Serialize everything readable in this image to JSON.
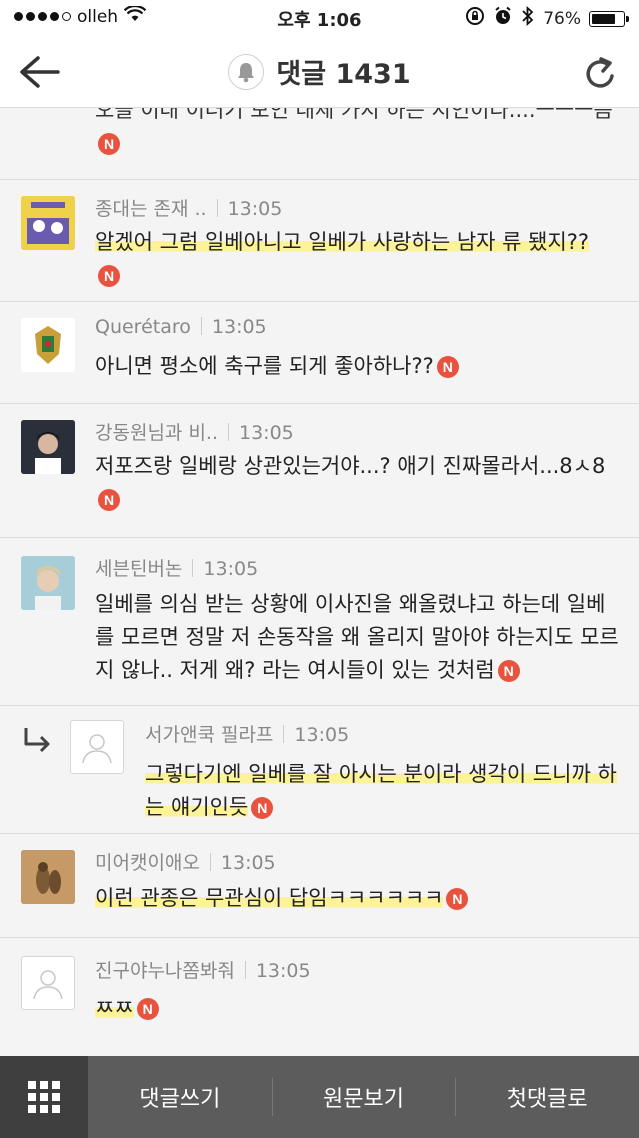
{
  "status_bar": {
    "carrier": "olleh",
    "time": "오후 1:06",
    "battery": "76%",
    "battery_level": 0.76
  },
  "header": {
    "title": "댓글 1431"
  },
  "comments": [
    {
      "text_prefix": "",
      "text": "오늘 이대 이러기 보인 대체 가지 하는 지인이다....ㅡㅡㅡ음",
      "partial": true
    },
    {
      "author": "종대는 존재 ..",
      "time": "13:05",
      "text": "알겠어 그럼 일베아니고 일베가 사랑하는 남자 류 됐지??",
      "avatar": "yellow-album-avatar"
    },
    {
      "author": "Querétaro",
      "time": "13:05",
      "text": "아니면 평소에 축구를 되게 좋아하나??",
      "avatar": "crest-avatar"
    },
    {
      "author": "강동원님과 비..",
      "time": "13:05",
      "text": "저포즈랑 일베랑 상관있는거야...? 애기 진짜몰라서...8ㅅ8",
      "avatar": "person-dark-avatar"
    },
    {
      "author": "세븐틴버논",
      "time": "13:05",
      "text": "일베를 의심 받는 상황에 이사진을 왜올렸냐고 하는데 일베를 모르면 정말 저 손동작을 왜 올리지 말아야 하는지도 모르지 않나.. 저게 왜? 라는 여시들이 있는 것처럼",
      "avatar": "person-light-avatar"
    },
    {
      "author": "서가앤쿡 필라프",
      "time": "13:05",
      "text": "그렇다기엔 일베를 잘 아시는 분이라 생각이 드니까 하는 얘기인듯",
      "avatar": "default-avatar",
      "reply": true
    },
    {
      "author": "미어캣이애오",
      "time": "13:05",
      "text": "이런 관종은 무관심이 답임ㅋㅋㅋㅋㅋㅋ",
      "avatar": "meerkat-avatar"
    },
    {
      "author": "진구야누나쫌봐줘",
      "time": "13:05",
      "text": "ㅉㅉ",
      "avatar": "default-avatar"
    }
  ],
  "badge_label": "N",
  "toolbar": {
    "write_comment": "댓글쓰기",
    "view_original": "원문보기",
    "first_comment": "첫댓글로"
  },
  "colors": {
    "badge": "#e8533f",
    "highlight": "#fff278",
    "toolbar_bg": "#5c5c5c",
    "grid_bg": "#3f3f3f"
  }
}
